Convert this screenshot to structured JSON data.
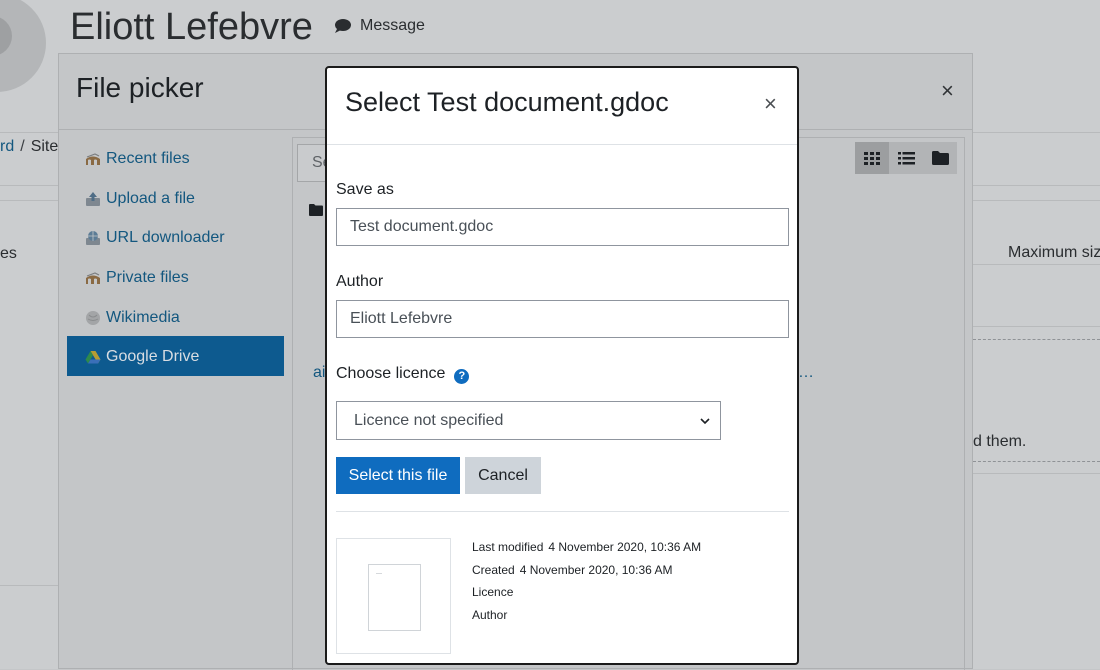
{
  "background": {
    "user_name": "Eliott Lefebvre",
    "message_label": "Message",
    "breadcrumb_partial": "rd",
    "breadcrumb_current_partial": "Site",
    "left_text_partial": "es",
    "max_size_partial": "Maximum siz",
    "drop_text_partial": "d them."
  },
  "file_picker": {
    "title": "File picker",
    "close_glyph": "×",
    "search_partial": "Se",
    "repositories": [
      {
        "label": "Recent files",
        "icon": "moodle-icon"
      },
      {
        "label": "Upload a file",
        "icon": "upload-icon"
      },
      {
        "label": "URL downloader",
        "icon": "url-icon"
      },
      {
        "label": "Private files",
        "icon": "moodle-icon"
      },
      {
        "label": "Wikimedia",
        "icon": "wikimedia-icon"
      },
      {
        "label": "Google Drive",
        "icon": "google-drive-icon",
        "active": true
      }
    ],
    "partial_link_left": "ai",
    "partial_link_right": "…"
  },
  "dialog": {
    "title": "Select Test document.gdoc",
    "close_glyph": "×",
    "save_as_label": "Save as",
    "save_as_value": "Test document.gdoc",
    "author_label": "Author",
    "author_value": "Eliott Lefebvre",
    "licence_label": "Choose licence",
    "licence_help_glyph": "?",
    "licence_selected": "Licence not specified",
    "select_button": "Select this file",
    "cancel_button": "Cancel",
    "meta": {
      "last_modified_label": "Last modified",
      "last_modified_value": "4 November 2020, 10:36 AM",
      "created_label": "Created",
      "created_value": "4 November 2020, 10:36 AM",
      "licence_label": "Licence",
      "author_label": "Author"
    }
  },
  "colors": {
    "accent": "#0f6cbf",
    "secondary_button": "#ced4da",
    "overlay_background": "#c4c6c8"
  }
}
